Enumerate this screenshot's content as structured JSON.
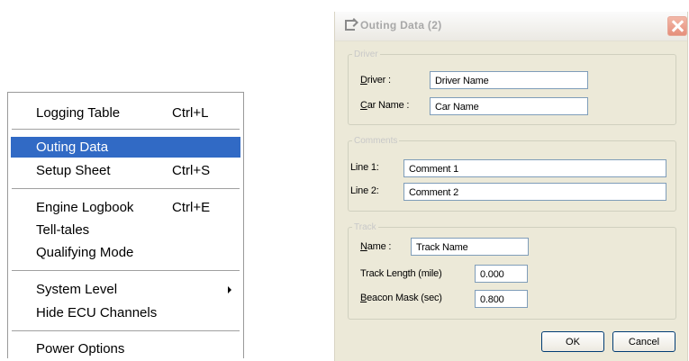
{
  "menu": {
    "items": [
      {
        "label": "Logging Table",
        "shortcut": "Ctrl+L"
      },
      {
        "label": "Outing Data",
        "shortcut": ""
      },
      {
        "label": "Setup Sheet",
        "shortcut": "Ctrl+S"
      },
      {
        "label": "Engine Logbook",
        "shortcut": "Ctrl+E"
      },
      {
        "label": "Tell-tales",
        "shortcut": ""
      },
      {
        "label": "Qualifying Mode",
        "shortcut": ""
      },
      {
        "label": "System Level",
        "shortcut": ""
      },
      {
        "label": "Hide ECU Channels",
        "shortcut": ""
      },
      {
        "label": "Power Options",
        "shortcut": ""
      }
    ],
    "selected_index": 1,
    "highlight_color": "#316ac5"
  },
  "dialog": {
    "title": "Outing Data (2)",
    "driver_group": {
      "legend": "Driver",
      "driver_label_first": "D",
      "driver_label_rest": "river :",
      "driver_value": "Driver Name",
      "car_label_first": "C",
      "car_label_rest": "ar Name :",
      "car_value": "Car Name"
    },
    "comments_group": {
      "legend": "Comments",
      "line1_label": "Line 1:",
      "line1_value": "Comment 1",
      "line2_label": "Line 2:",
      "line2_value": "Comment 2"
    },
    "track_group": {
      "legend": "Track",
      "name_label_first": "N",
      "name_label_rest": "ame :",
      "name_value": "Track Name",
      "length_label": "Track Length (mile)",
      "length_value": "0.000",
      "beacon_label_first": "B",
      "beacon_label_rest": "eacon Mask (sec)",
      "beacon_value": "0.800"
    },
    "ok_label": "OK",
    "cancel_label": "Cancel"
  }
}
